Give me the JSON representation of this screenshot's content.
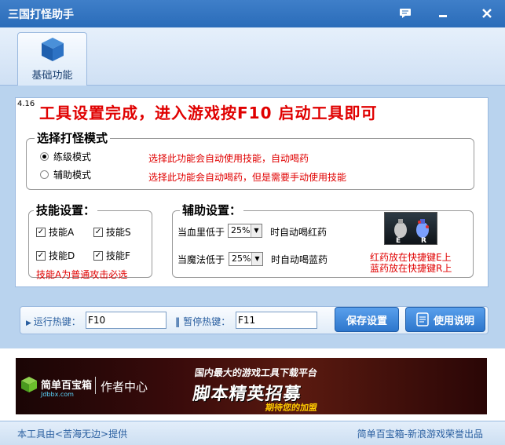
{
  "window": {
    "title": "三国打怪助手",
    "icons": [
      "chat-icon",
      "minimize-icon",
      "close-icon"
    ]
  },
  "nav": {
    "tab_label": "基础功能",
    "tab_icon": "cube-icon"
  },
  "main": {
    "version": "4.16",
    "headline": "工具设置完成，进入游戏按F10 启动工具即可",
    "mode_group": {
      "title": "选择打怪模式",
      "options": [
        {
          "label": "练级模式",
          "selected": true,
          "desc": "选择此功能会自动使用技能，自动喝药"
        },
        {
          "label": "辅助模式",
          "selected": false,
          "desc": "选择此功能会自动喝药，但是需要手动使用技能"
        }
      ]
    },
    "skill_group": {
      "title": "技能设置：",
      "skills": [
        {
          "label": "技能A",
          "checked": true
        },
        {
          "label": "技能S",
          "checked": true
        },
        {
          "label": "技能D",
          "checked": true
        },
        {
          "label": "技能F",
          "checked": true
        }
      ],
      "note": "技能A为普通攻击必选"
    },
    "assist_group": {
      "title": "辅助设置：",
      "hp": {
        "prefix": "当血里低于",
        "value": "25%",
        "suffix": "时自动喝红药"
      },
      "mp": {
        "prefix": "当魔法低于",
        "value": "25%",
        "suffix": "时自动喝蓝药"
      },
      "potion_keys": [
        "E",
        "R"
      ],
      "hint_line1": "红药放在快捷键E上",
      "hint_line2": "蓝药放在快捷键R上"
    }
  },
  "hotkeys": {
    "run_label": "运行热键：",
    "run_value": "F10",
    "pause_label": "暂停热键：",
    "pause_value": "F11",
    "save_button": "保存设置",
    "help_button": "使用说明"
  },
  "banner": {
    "brand": "简单百宝箱",
    "brand_sub": "Jdbbx.com",
    "center": "作者中心",
    "top_line": "国内最大的游戏工具下载平台",
    "big_line": "脚本精英招募",
    "slogan": "期待您的加盟"
  },
  "footer": {
    "left": "本工具由<苦海无边>提供",
    "right": "简单百宝箱-新浪游戏荣誉出品"
  },
  "colors": {
    "accent_blue": "#2a6cb9",
    "warning_red": "#e00000",
    "band_blue": "#b9d3ee"
  }
}
